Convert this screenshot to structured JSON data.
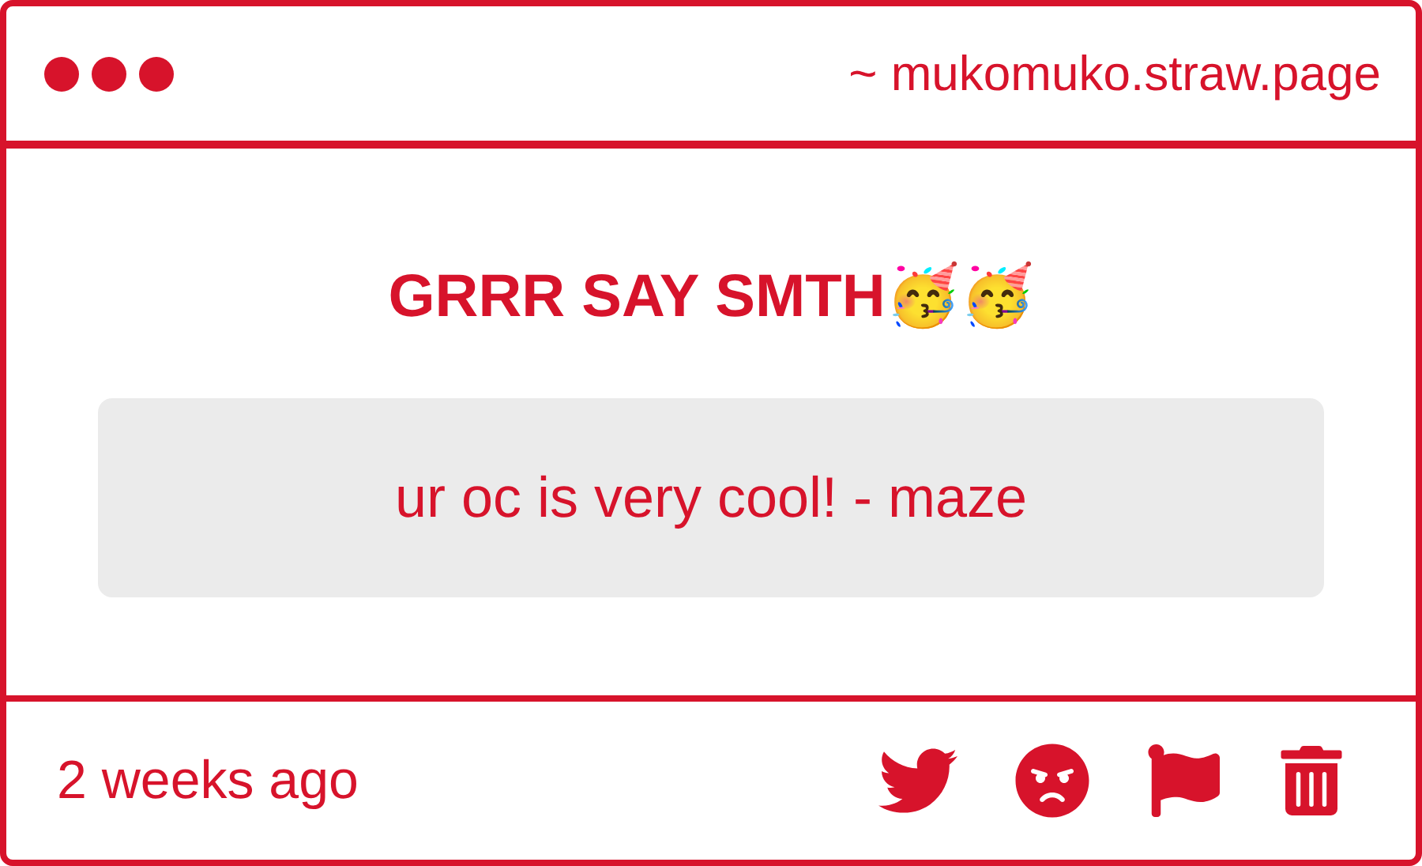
{
  "window": {
    "url": "~ mukomuko.straw.page"
  },
  "message": {
    "title": "GRRR SAY SMTH🥳🥳",
    "text": "ur oc is very cool! - maze"
  },
  "footer": {
    "time": "2 weeks ago"
  }
}
